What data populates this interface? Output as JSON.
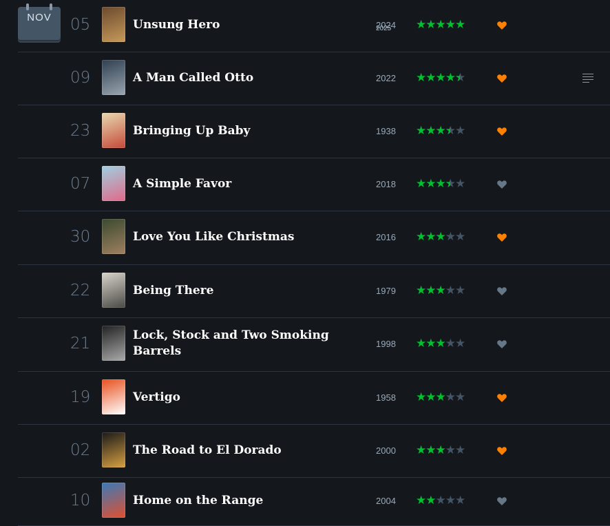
{
  "calendar": {
    "month": "NOV",
    "year": "2025"
  },
  "colors": {
    "liked": "#ff8000",
    "not_liked": "#667788",
    "star_on": "#00c030",
    "star_off": "#445566"
  },
  "entries": [
    {
      "day": "05",
      "title": "Unsung Hero",
      "year": "2024",
      "rating": 5,
      "liked": true,
      "has_review": false
    },
    {
      "day": "09",
      "title": "A Man Called Otto",
      "year": "2022",
      "rating": 4.5,
      "liked": true,
      "has_review": true
    },
    {
      "day": "23",
      "title": "Bringing Up Baby",
      "year": "1938",
      "rating": 3.5,
      "liked": true,
      "has_review": false
    },
    {
      "day": "07",
      "title": "A Simple Favor",
      "year": "2018",
      "rating": 3.5,
      "liked": false,
      "has_review": false
    },
    {
      "day": "30",
      "title": "Love You Like Christmas",
      "year": "2016",
      "rating": 3,
      "liked": true,
      "has_review": false
    },
    {
      "day": "22",
      "title": "Being There",
      "year": "1979",
      "rating": 3,
      "liked": false,
      "has_review": false
    },
    {
      "day": "21",
      "title": "Lock, Stock and Two Smoking Barrels",
      "year": "1998",
      "rating": 3,
      "liked": false,
      "has_review": false
    },
    {
      "day": "19",
      "title": "Vertigo",
      "year": "1958",
      "rating": 3,
      "liked": true,
      "has_review": false
    },
    {
      "day": "02",
      "title": "The Road to El Dorado",
      "year": "2000",
      "rating": 3,
      "liked": true,
      "has_review": false
    },
    {
      "day": "10",
      "title": "Home on the Range",
      "year": "2004",
      "rating": 2,
      "liked": false,
      "has_review": false
    }
  ]
}
